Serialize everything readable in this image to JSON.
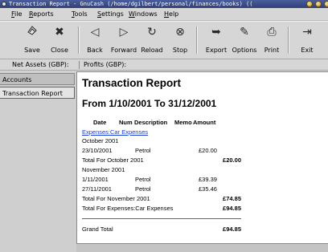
{
  "window": {
    "title": "Transaction Report - GnuCash (/home/dgilbert/personal/finances/books) ((",
    "controls": [
      "minimize",
      "maximize",
      "close"
    ]
  },
  "menu": [
    "File",
    "Reports",
    "Tools",
    "Settings",
    "Windows",
    "Help"
  ],
  "toolbar": [
    {
      "label": "Save",
      "icon": "save-icon"
    },
    {
      "label": "Close",
      "icon": "close-icon"
    },
    {
      "label": "Back",
      "icon": "back-arrow-icon"
    },
    {
      "label": "Forward",
      "icon": "forward-arrow-icon"
    },
    {
      "label": "Reload",
      "icon": "reload-icon"
    },
    {
      "label": "Stop",
      "icon": "stop-icon"
    },
    {
      "label": "Export",
      "icon": "export-icon"
    },
    {
      "label": "Options",
      "icon": "options-icon"
    },
    {
      "label": "Print",
      "icon": "print-icon"
    },
    {
      "label": "Exit",
      "icon": "exit-icon"
    }
  ],
  "summary": {
    "net_assets": "Net Assets (GBP):",
    "profits": "Profits (GBP):"
  },
  "tabs": [
    {
      "label": "Accounts",
      "active": false
    },
    {
      "label": "Transaction Report",
      "active": true
    }
  ],
  "report": {
    "title": "Transaction Report",
    "period": "From 1/10/2001 To 31/12/2001",
    "columns": [
      "Date",
      "Num",
      "Description",
      "Memo",
      "Amount"
    ],
    "account_link": "Expenses:Car Expenses",
    "month_oct": "October 2001",
    "tx1": {
      "date": "23/10/2001",
      "description": "Petrol",
      "amount": "£20.00"
    },
    "total_oct": {
      "label": "Total For October 2001",
      "amount": "£20.00"
    },
    "month_nov": "November 2001",
    "tx2": {
      "date": "1/11/2001",
      "description": "Petrol",
      "amount": "£39.39"
    },
    "tx3": {
      "date": "27/11/2001",
      "description": "Petrol",
      "amount": "£35.46"
    },
    "total_nov": {
      "label": "Total For November 2001",
      "amount": "£74.85"
    },
    "total_account": {
      "label": "Total For Expenses:Car Expenses",
      "amount": "£94.85"
    },
    "grand_total": {
      "label": "Grand Total",
      "amount": "£94.85"
    }
  }
}
